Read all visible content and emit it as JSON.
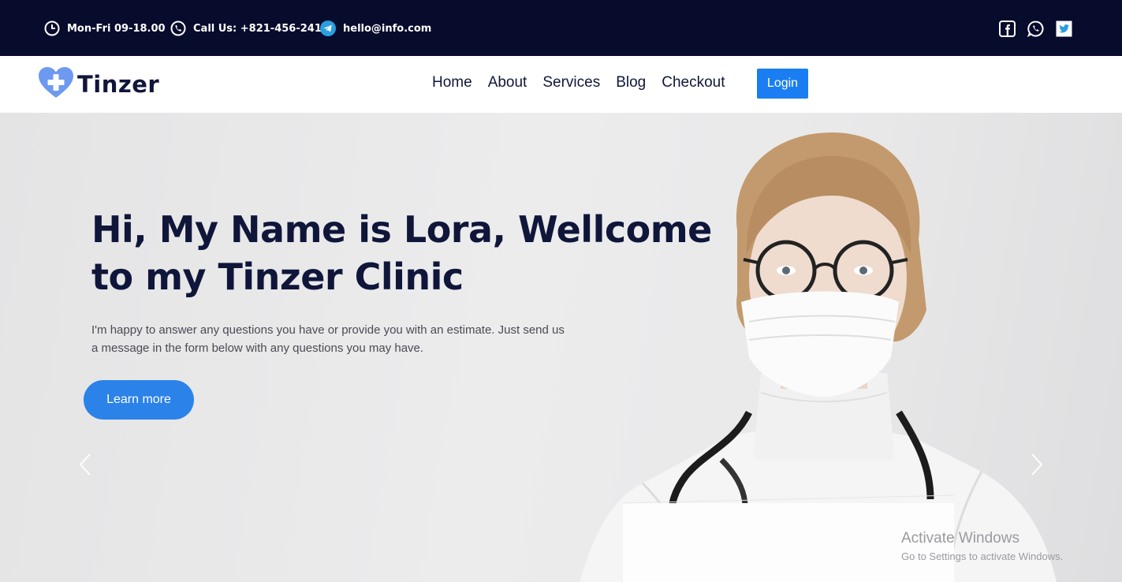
{
  "topbar": {
    "hours": "Mon-Fri 09-18.00",
    "call": "Call Us: +821-456-241",
    "email": "hello@info.com",
    "hours_icon": "clock-icon",
    "call_icon": "phone-icon",
    "email_icon": "telegram-icon",
    "social": [
      "facebook-icon",
      "whatsapp-icon",
      "twitter-icon"
    ]
  },
  "brand": {
    "name": "Tinzer",
    "logo_icon": "heart-cross-icon"
  },
  "nav": {
    "links": [
      "Home",
      "About",
      "Services",
      "Blog",
      "Checkout"
    ],
    "login": "Login"
  },
  "hero": {
    "title_line1": "Hi, My Name is Lora, Wellcome",
    "title_line2": "to my Tinzer Clinic",
    "desc_line1": "I'm happy to answer any questions you have or provide you with an estimate. Just send us",
    "desc_line2": "a message in the form below with any questions you may have.",
    "button": "Learn more",
    "prev_icon": "chevron-left-icon",
    "next_icon": "chevron-right-icon"
  },
  "watermark": {
    "title": "Activate Windows",
    "subtitle": "Go to Settings to activate Windows."
  },
  "colors": {
    "topbar_bg": "#070b2c",
    "brand_dark": "#10163a",
    "accent_blue": "#1a7ef2",
    "logo_blue": "#5b8def"
  }
}
